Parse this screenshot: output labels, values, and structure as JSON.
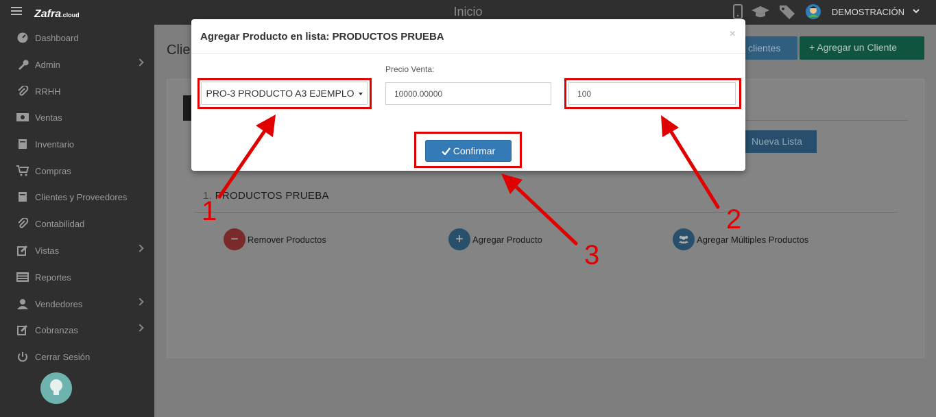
{
  "topbar": {
    "brand": "Zafra",
    "brand_suffix": ".cloud",
    "title": "Inicio",
    "user_name": "DEMOSTRACIÓN"
  },
  "sidebar": {
    "items": [
      {
        "label": "Dashboard",
        "icon": "dashboard-icon",
        "has_submenu": false
      },
      {
        "label": "Admin",
        "icon": "wrench-icon",
        "has_submenu": true
      },
      {
        "label": "RRHH",
        "icon": "paperclip-icon",
        "has_submenu": false
      },
      {
        "label": "Ventas",
        "icon": "money-icon",
        "has_submenu": false
      },
      {
        "label": "Inventario",
        "icon": "book-icon",
        "has_submenu": false
      },
      {
        "label": "Compras",
        "icon": "cart-icon",
        "has_submenu": false
      },
      {
        "label": "Clientes y Proveedores",
        "icon": "book-icon",
        "has_submenu": false
      },
      {
        "label": "Contabilidad",
        "icon": "paperclip-icon",
        "has_submenu": false
      },
      {
        "label": "Vistas",
        "icon": "edit-icon",
        "has_submenu": true
      },
      {
        "label": "Reportes",
        "icon": "list-icon",
        "has_submenu": false
      },
      {
        "label": "Vendedores",
        "icon": "user-icon",
        "has_submenu": true
      },
      {
        "label": "Cobranzas",
        "icon": "edit-icon",
        "has_submenu": true
      },
      {
        "label": "Cerrar Sesión",
        "icon": "power-icon",
        "has_submenu": false
      }
    ]
  },
  "page": {
    "heading": "Clie",
    "clients_button": "clientes",
    "add_client_button": "+ Agregar un Cliente",
    "new_list_button": "Nueva Lista",
    "list_number": "1.",
    "list_name": "PRODUCTOS PRUEBA",
    "actions": {
      "remove": "Remover Productos",
      "add": "Agregar Producto",
      "add_multiple": "Agregar Múltiples Productos"
    }
  },
  "modal": {
    "title": "Agregar Producto en lista: PRODUCTOS PRUEBA",
    "close": "×",
    "product_selected": "PRO-3 PRODUCTO A3 EJEMPLO",
    "price_label": "Precio Venta:",
    "price_value": "10000.00000",
    "quantity_value": "100",
    "confirm_label": "Confirmar"
  },
  "annotations": {
    "labels": [
      "1",
      "2",
      "3"
    ],
    "color": "#e00000"
  },
  "colors": {
    "primary": "#337ab7",
    "sidebar_bg": "#2f2f2f",
    "success": "#1b9a74",
    "danger": "#c9302c"
  }
}
